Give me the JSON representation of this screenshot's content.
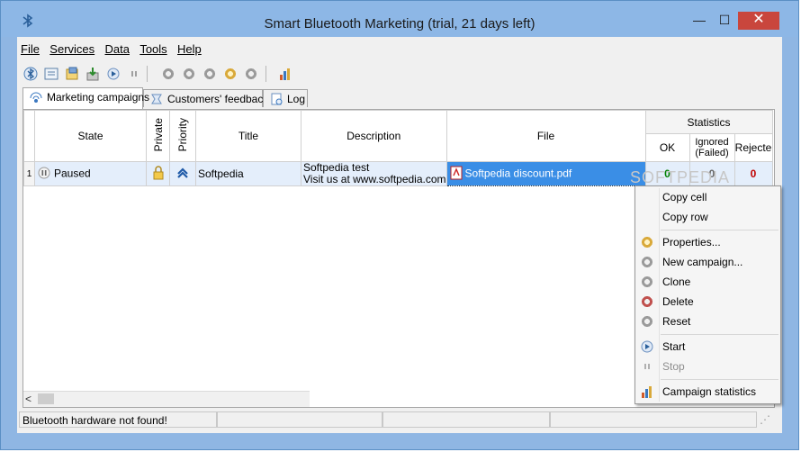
{
  "window": {
    "title": "Smart Bluetooth Marketing (trial, 21 days left)",
    "minimize_glyph": "—",
    "maximize_glyph": "☐",
    "close_glyph": "✕"
  },
  "menu": [
    {
      "label": "File"
    },
    {
      "label": "Services"
    },
    {
      "label": "Data"
    },
    {
      "label": "Tools"
    },
    {
      "label": "Help"
    }
  ],
  "toolbar": {
    "icons": [
      "bluetooth-search-icon",
      "properties-icon",
      "export-icon",
      "import-icon",
      "start-icon",
      "stop-icon",
      "gear-icon",
      "gear-add-icon",
      "gear-delete-icon",
      "gear-edit-icon",
      "gear-reset-icon",
      "statistics-icon"
    ]
  },
  "tabs": [
    {
      "label": "Marketing campaigns",
      "active": true
    },
    {
      "label": "Customers' feedback",
      "active": false
    },
    {
      "label": "Log",
      "active": false
    }
  ],
  "grid": {
    "headers": {
      "state": "State",
      "private": "Private",
      "priority": "Priority",
      "title": "Title",
      "description": "Description",
      "file": "File",
      "statistics": "Statistics",
      "ok": "OK",
      "ignored": "Ignored",
      "ignored2": "(Failed)",
      "rejected": "Rejecte"
    },
    "rows": [
      {
        "num": "1",
        "state": "Paused",
        "title": "Softpedia",
        "description_line1": "Softpedia test",
        "description_line2": "Visit us at www.softpedia.com",
        "file": "Softpedia discount.pdf",
        "ok": "0",
        "ignored": "0",
        "rejected": "0"
      }
    ],
    "scroll_left_glyph": "<"
  },
  "status": {
    "message": "Bluetooth hardware not found!"
  },
  "watermark": "SOFTPEDIA",
  "context_menu": {
    "items": [
      {
        "label": "Copy cell"
      },
      {
        "label": "Copy row"
      },
      {
        "label": "Properties..."
      },
      {
        "label": "New campaign..."
      },
      {
        "label": "Clone"
      },
      {
        "label": "Delete"
      },
      {
        "label": "Reset"
      },
      {
        "label": "Start"
      },
      {
        "label": "Stop"
      },
      {
        "label": "Campaign statistics"
      }
    ]
  },
  "colors": {
    "title_bar": "#8db7e6",
    "selection": "#3a8ee6",
    "row_highlight": "#e4eefb",
    "close_button": "#c9463d",
    "ok_green": "#008000",
    "rejected_red": "#c00000"
  }
}
